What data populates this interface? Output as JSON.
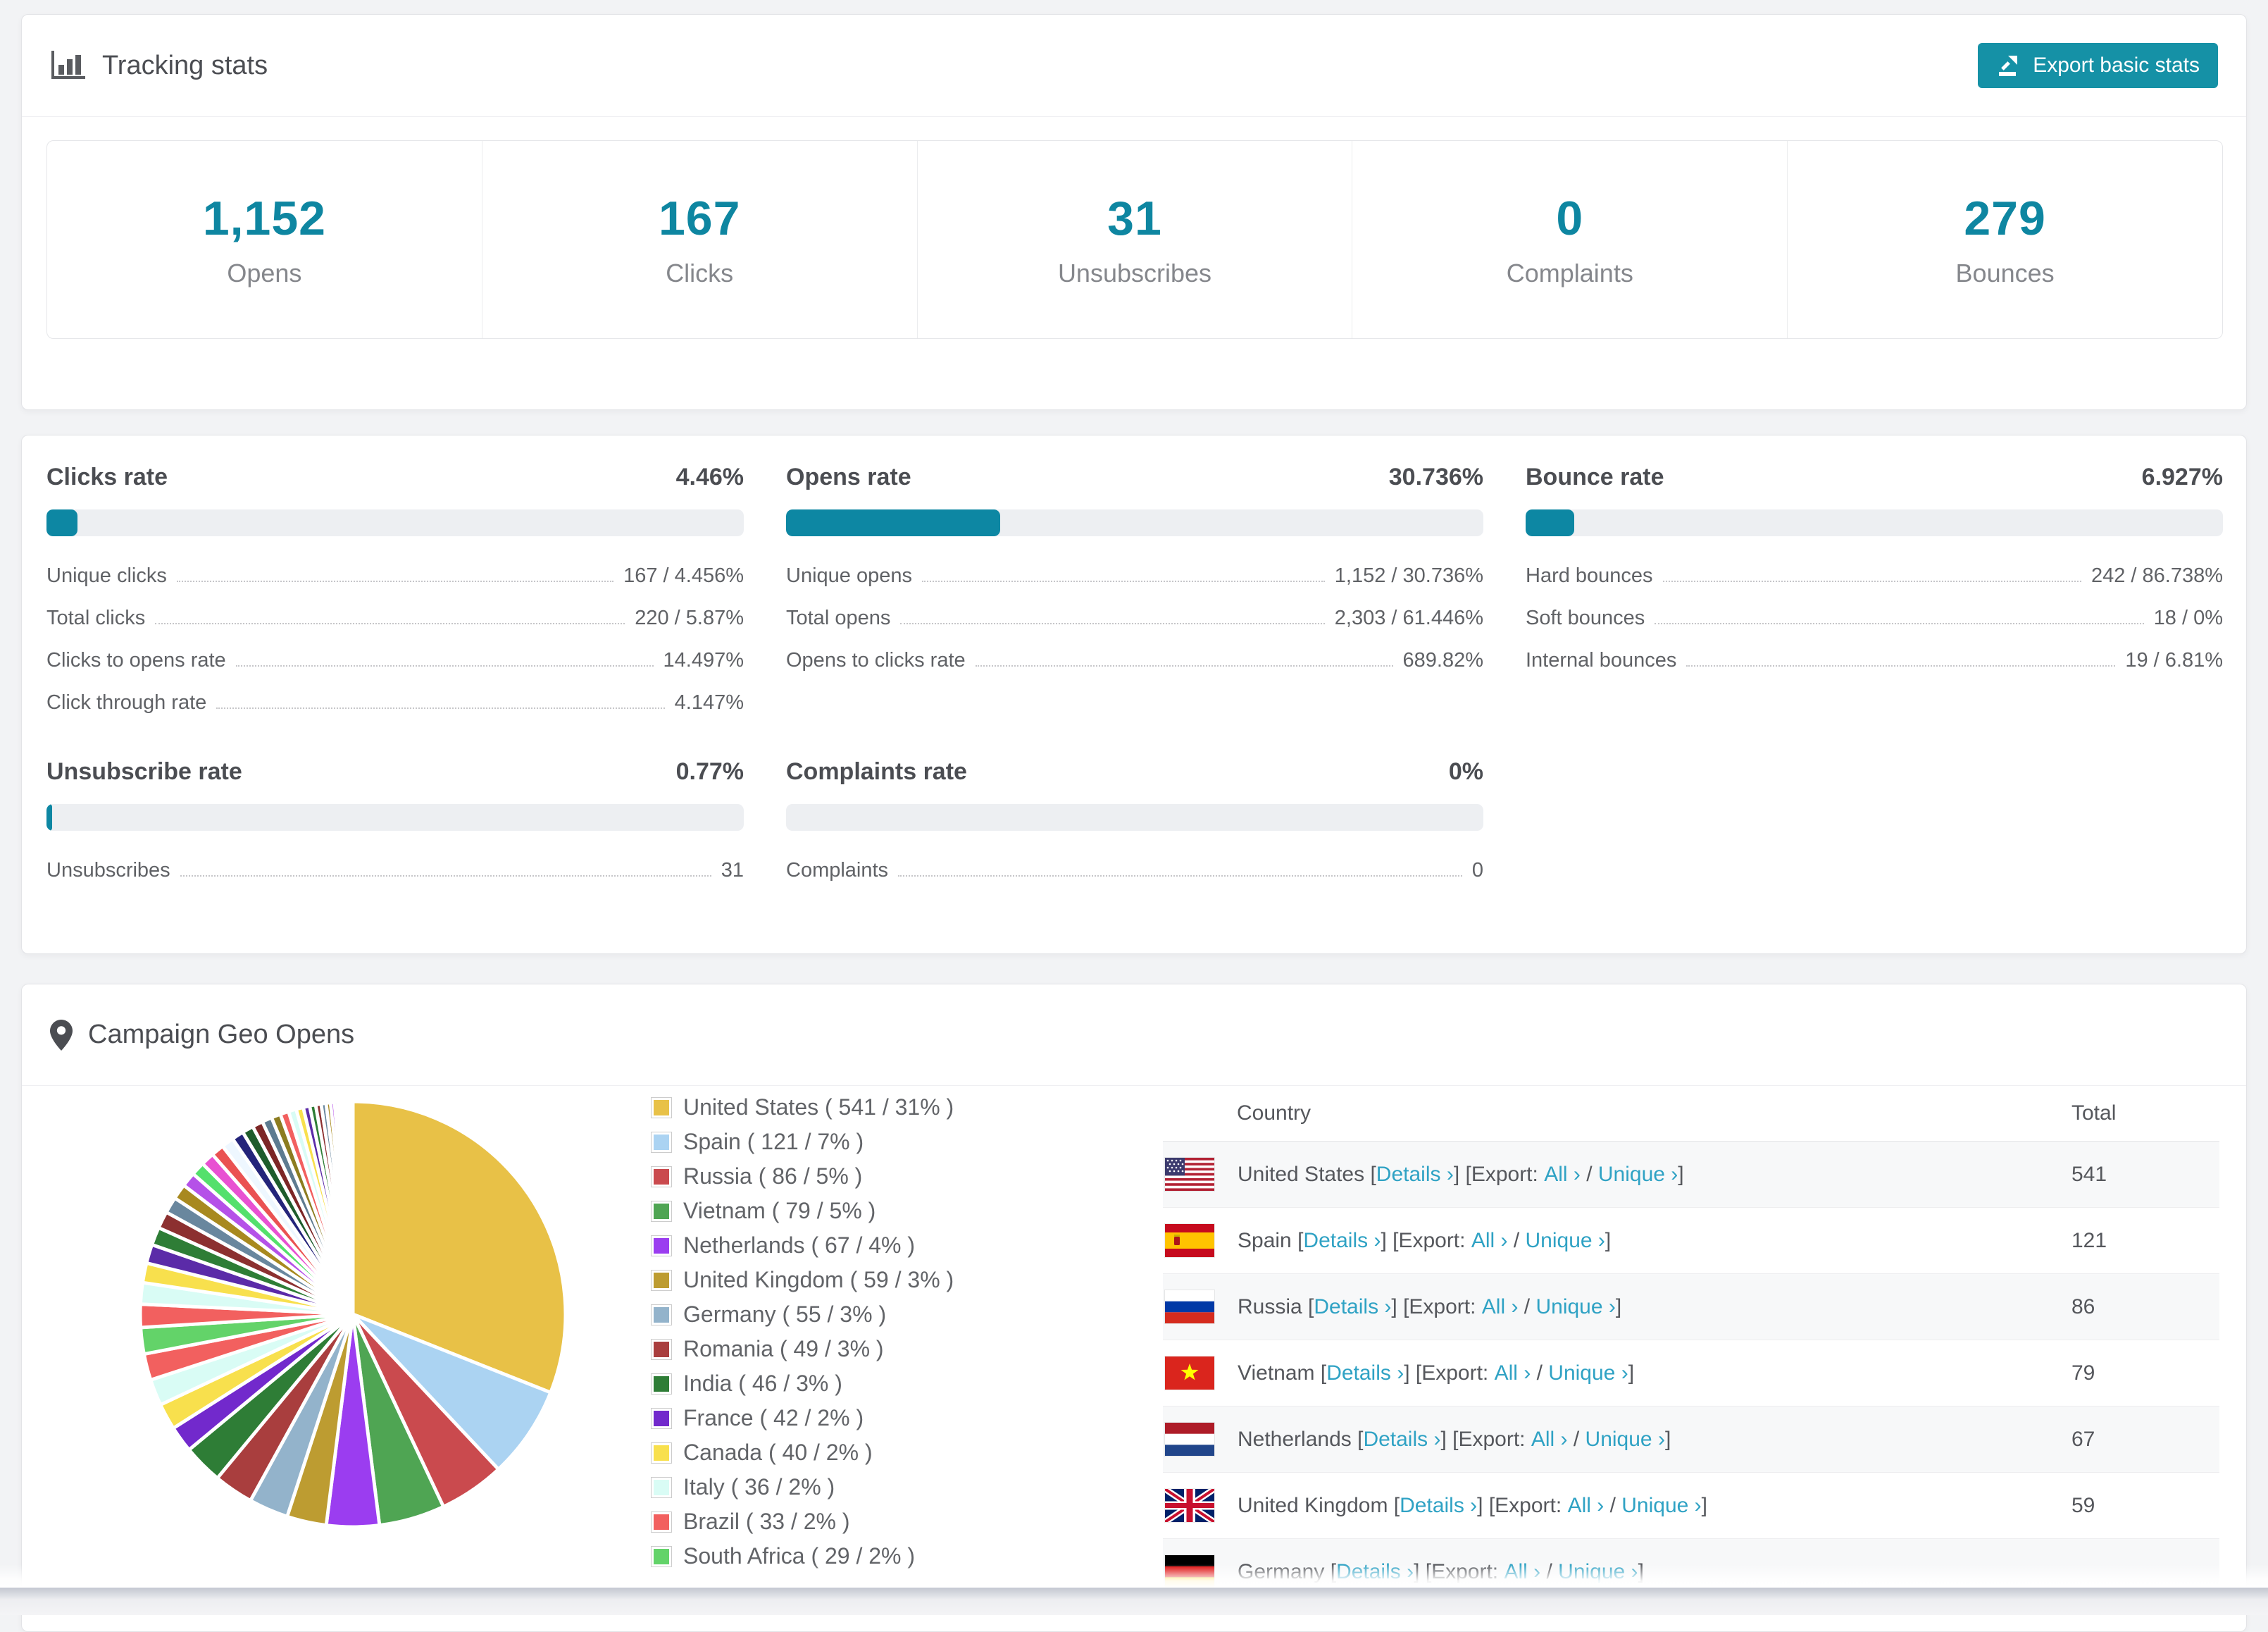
{
  "icons": {
    "tracking": "bar-chart-icon",
    "export": "export-upload-icon",
    "geo": "map-pin-icon"
  },
  "tracking": {
    "title": "Tracking stats",
    "export_button": "Export basic stats",
    "stats": [
      {
        "value": "1,152",
        "label": "Opens"
      },
      {
        "value": "167",
        "label": "Clicks"
      },
      {
        "value": "31",
        "label": "Unsubscribes"
      },
      {
        "value": "0",
        "label": "Complaints"
      },
      {
        "value": "279",
        "label": "Bounces"
      }
    ]
  },
  "rates": {
    "clicks": {
      "title": "Clicks rate",
      "value": "4.46%",
      "fill": "4.46%",
      "rows": [
        {
          "label": "Unique clicks",
          "value": "167 / 4.456%"
        },
        {
          "label": "Total clicks",
          "value": "220 / 5.87%"
        },
        {
          "label": "Clicks to opens rate",
          "value": "14.497%"
        },
        {
          "label": "Click through rate",
          "value": "4.147%"
        }
      ]
    },
    "opens": {
      "title": "Opens rate",
      "value": "30.736%",
      "fill": "30.736%",
      "rows": [
        {
          "label": "Unique opens",
          "value": "1,152 / 30.736%"
        },
        {
          "label": "Total opens",
          "value": "2,303 / 61.446%"
        },
        {
          "label": "Opens to clicks rate",
          "value": "689.82%"
        }
      ]
    },
    "bounce": {
      "title": "Bounce rate",
      "value": "6.927%",
      "fill": "6.927%",
      "rows": [
        {
          "label": "Hard bounces",
          "value": "242 / 86.738%"
        },
        {
          "label": "Soft bounces",
          "value": "18 / 0%"
        },
        {
          "label": "Internal bounces",
          "value": "19 / 6.81%"
        }
      ]
    },
    "unsubscribe": {
      "title": "Unsubscribe rate",
      "value": "0.77%",
      "fill": "0.77%",
      "rows": [
        {
          "label": "Unsubscribes",
          "value": "31"
        }
      ]
    },
    "complaints": {
      "title": "Complaints rate",
      "value": "0%",
      "fill": "0%",
      "rows": [
        {
          "label": "Complaints",
          "value": "0"
        }
      ]
    }
  },
  "geo": {
    "title": "Campaign Geo Opens",
    "table": {
      "country_header": "Country",
      "total_header": "Total",
      "bracket1": " [",
      "link_details": "Details ›",
      "bracket2": "] [Export: ",
      "link_all": "All ›",
      "slash": " / ",
      "link_unique": "Unique ›",
      "bracket3": "]",
      "rows": [
        {
          "country": "United States",
          "total": "541",
          "flag": "us"
        },
        {
          "country": "Spain",
          "total": "121",
          "flag": "es"
        },
        {
          "country": "Russia",
          "total": "86",
          "flag": "ru"
        },
        {
          "country": "Vietnam",
          "total": "79",
          "flag": "vn"
        },
        {
          "country": "Netherlands",
          "total": "67",
          "flag": "nl"
        },
        {
          "country": "United Kingdom",
          "total": "59",
          "flag": "gb"
        },
        {
          "country": "Germany",
          "total": "",
          "flag": "de"
        }
      ]
    }
  },
  "chart_data": {
    "type": "pie",
    "title": "Campaign Geo Opens",
    "legend_position": "right",
    "start_angle_deg": 0,
    "direction": "clockwise",
    "slices": [
      {
        "label": "United States",
        "count": 541,
        "pct": 31,
        "color": "#e8c147",
        "display": "United States ( 541 / 31% )"
      },
      {
        "label": "Spain",
        "count": 121,
        "pct": 7,
        "color": "#abd3f2",
        "display": "Spain ( 121 / 7% )"
      },
      {
        "label": "Russia",
        "count": 86,
        "pct": 5,
        "color": "#ca4a4e",
        "display": "Russia ( 86 / 5% )"
      },
      {
        "label": "Vietnam",
        "count": 79,
        "pct": 5,
        "color": "#4fa553",
        "display": "Vietnam ( 79 / 5% )"
      },
      {
        "label": "Netherlands",
        "count": 67,
        "pct": 4,
        "color": "#9b3df0",
        "display": "Netherlands ( 67 / 4% )"
      },
      {
        "label": "United Kingdom",
        "count": 59,
        "pct": 3,
        "color": "#bd9c31",
        "display": "United Kingdom ( 59 / 3% )"
      },
      {
        "label": "Germany",
        "count": 55,
        "pct": 3,
        "color": "#93b3cb",
        "display": "Germany ( 55 / 3% )"
      },
      {
        "label": "Romania",
        "count": 49,
        "pct": 3,
        "color": "#a93e3e",
        "display": "Romania ( 49 / 3% )"
      },
      {
        "label": "India",
        "count": 46,
        "pct": 3,
        "color": "#2e7d36",
        "display": "India ( 46 / 3% )"
      },
      {
        "label": "France",
        "count": 42,
        "pct": 2,
        "color": "#7229cc",
        "display": "France ( 42 / 2% )"
      },
      {
        "label": "Canada",
        "count": 40,
        "pct": 2,
        "color": "#f8e04d",
        "display": "Canada ( 40 / 2% )"
      },
      {
        "label": "Italy",
        "count": 36,
        "pct": 2,
        "color": "#d9fcf5",
        "display": "Italy ( 36 / 2% )"
      },
      {
        "label": "Brazil",
        "count": 33,
        "pct": 2,
        "color": "#f2605f",
        "display": "Brazil ( 33 / 2% )"
      },
      {
        "label": "South Africa",
        "count": 29,
        "pct": 2,
        "color": "#63d369",
        "display": "South Africa ( 29 / 2% )"
      }
    ],
    "other_slices": {
      "total_pct": 26,
      "weights": [
        1.35,
        1.25,
        1.15,
        1.1,
        1.05,
        1.0,
        0.95,
        0.9,
        0.85,
        0.8,
        0.78,
        0.75,
        0.72,
        0.7,
        0.66,
        0.62,
        0.58,
        0.54,
        0.5,
        0.46,
        0.42,
        0.38,
        0.35,
        0.32,
        0.29,
        0.26,
        0.23,
        0.2,
        0.17,
        0.15,
        0.13,
        0.11,
        0.09,
        0.08,
        0.07,
        0.06
      ],
      "colors": [
        "#f2605f",
        "#d9fcf5",
        "#f8e04d",
        "#5b2ba8",
        "#2e7d36",
        "#8c3030",
        "#69879e",
        "#a8891f",
        "#b551e8",
        "#54e06c",
        "#e851d2",
        "#ea5252",
        "#eef7ff",
        "#24247a",
        "#1e5c2c",
        "#7c2626",
        "#5d7b90",
        "#8c7c20"
      ]
    }
  }
}
